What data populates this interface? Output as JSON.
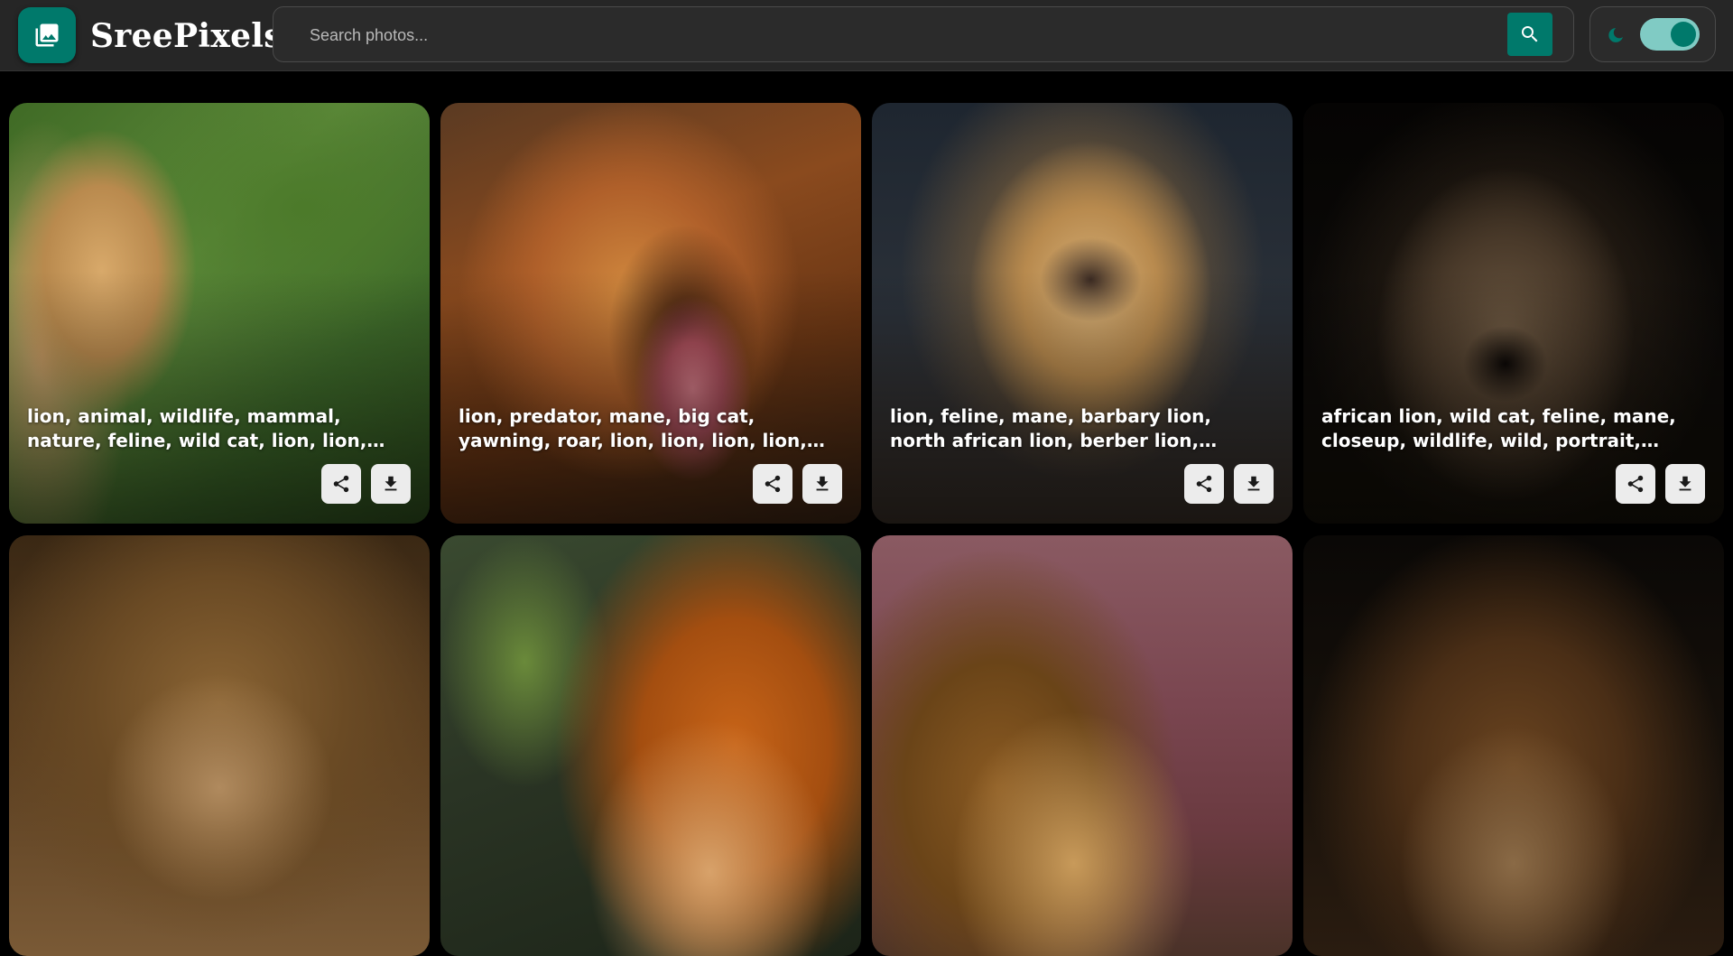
{
  "header": {
    "logo_text": "SreePixels",
    "logo_icon": "photo-library-icon",
    "brand_color": "#00796b",
    "search": {
      "placeholder": "Search photos...",
      "value": "",
      "button_icon": "search-icon"
    },
    "theme_toggle": {
      "icon": "moon-icon",
      "state": "on"
    }
  },
  "gallery": {
    "cards": [
      {
        "caption": "lion, animal, wildlife, mammal, nature, feline, wild cat, lion, lion, lion, lion, lion",
        "share_icon": "share-icon",
        "download_icon": "download-icon"
      },
      {
        "caption": "lion, predator, mane, big cat, yawning, roar, lion, lion, lion, lion, nature, lion",
        "share_icon": "share-icon",
        "download_icon": "download-icon"
      },
      {
        "caption": "lion, feline, mane, barbary lion, north african lion, berber lion, egyptian lion, ...",
        "share_icon": "share-icon",
        "download_icon": "download-icon"
      },
      {
        "caption": "african lion, wild cat, feline, mane, closeup, wildlife, wild, portrait, nature, f...",
        "share_icon": "share-icon",
        "download_icon": "download-icon"
      },
      {
        "caption": ""
      },
      {
        "caption": ""
      },
      {
        "caption": ""
      },
      {
        "caption": ""
      }
    ]
  }
}
